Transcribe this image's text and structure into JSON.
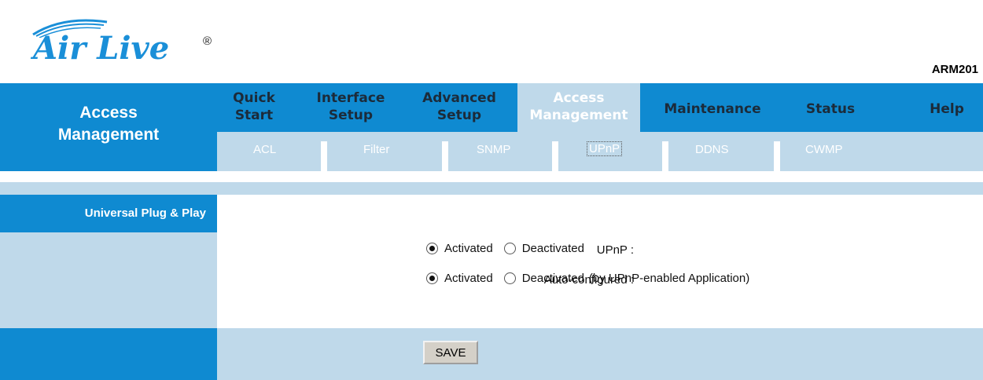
{
  "header": {
    "brand": "Air Live",
    "registered_mark": "®",
    "model": "ARM201"
  },
  "nav": {
    "section": [
      "Access",
      "Management"
    ],
    "tabs": [
      {
        "line1": "Quick",
        "line2": "Start",
        "active": false
      },
      {
        "line1": "Interface",
        "line2": "Setup",
        "active": false
      },
      {
        "line1": "Advanced",
        "line2": "Setup",
        "active": false
      },
      {
        "line1": "Access",
        "line2": "Management",
        "active": true
      },
      {
        "line1": "Maintenance",
        "line2": "",
        "active": false
      },
      {
        "line1": "Status",
        "line2": "",
        "active": false
      },
      {
        "line1": "Help",
        "line2": "",
        "active": false
      }
    ],
    "subtabs": [
      "ACL",
      "Filter",
      "SNMP",
      "UPnP",
      "DDNS",
      "CWMP"
    ],
    "selected_subtab": "UPnP"
  },
  "section": {
    "title": "Universal Plug & Play"
  },
  "form": {
    "upnp": {
      "label": "UPnP :",
      "opt_on": "Activated",
      "opt_off": "Deactivated",
      "value": "Activated"
    },
    "autoconf": {
      "label": "Auto-configured :",
      "opt_on": "Activated",
      "opt_off": "Deactivated",
      "note": "(by UPnP-enabled Application)",
      "value": "Activated"
    }
  },
  "footer": {
    "save_label": "SAVE"
  },
  "colors": {
    "primary_blue": "#0f8ad1",
    "light_blue": "#bfd9ea"
  }
}
